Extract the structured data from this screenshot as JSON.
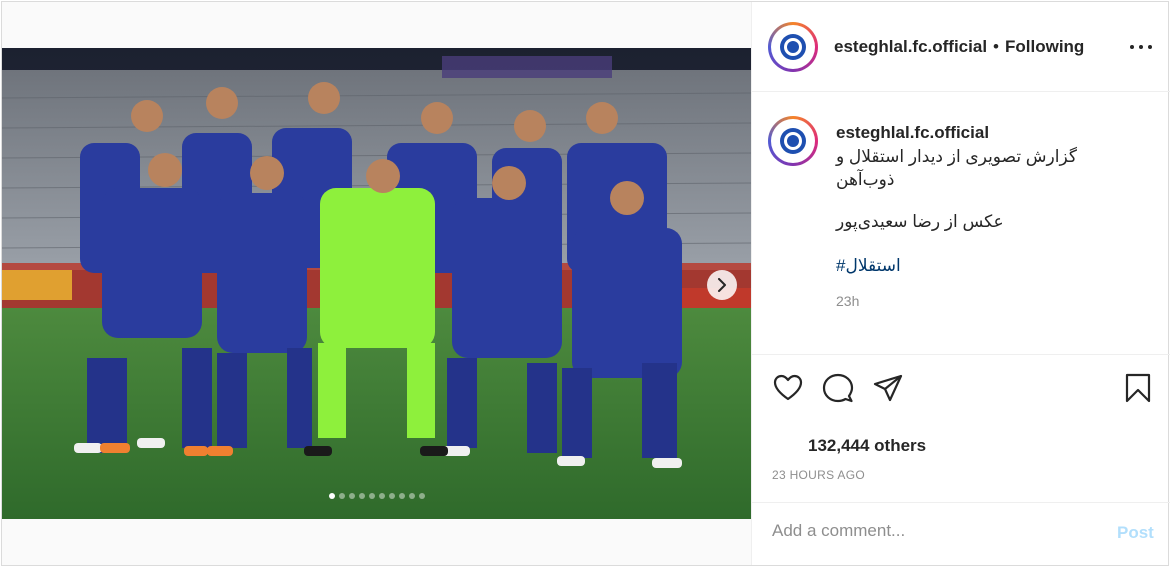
{
  "post": {
    "username": "esteghlal.fc.official",
    "separator": "•",
    "follow_status": "Following",
    "more_icon": "ellipsis-icon"
  },
  "caption": {
    "username": "esteghlal.fc.official",
    "line1": "گزارش تصویری از دیدار استقلال و",
    "line2": "ذوب‌آهن",
    "line3": "عکس از رضا سعیدی‌پور",
    "hashtag": "#استقلال",
    "time": "23h"
  },
  "actions": {
    "like_icon": "heart-icon",
    "comment_icon": "comment-icon",
    "share_icon": "share-icon",
    "save_icon": "bookmark-icon"
  },
  "likes_text": "132,444 others",
  "timestamp": "23 HOURS AGO",
  "comment": {
    "placeholder": "Add a comment...",
    "post_label": "Post"
  },
  "carousel": {
    "total": 10,
    "active_index": 0,
    "next_icon": "chevron-right-icon"
  },
  "colors": {
    "jersey": "#2a3c9e",
    "goalkeeper": "#8ef03c",
    "pitch": "#3f7f3a",
    "link": "#00376b",
    "post_disabled": "#b2dffc"
  }
}
